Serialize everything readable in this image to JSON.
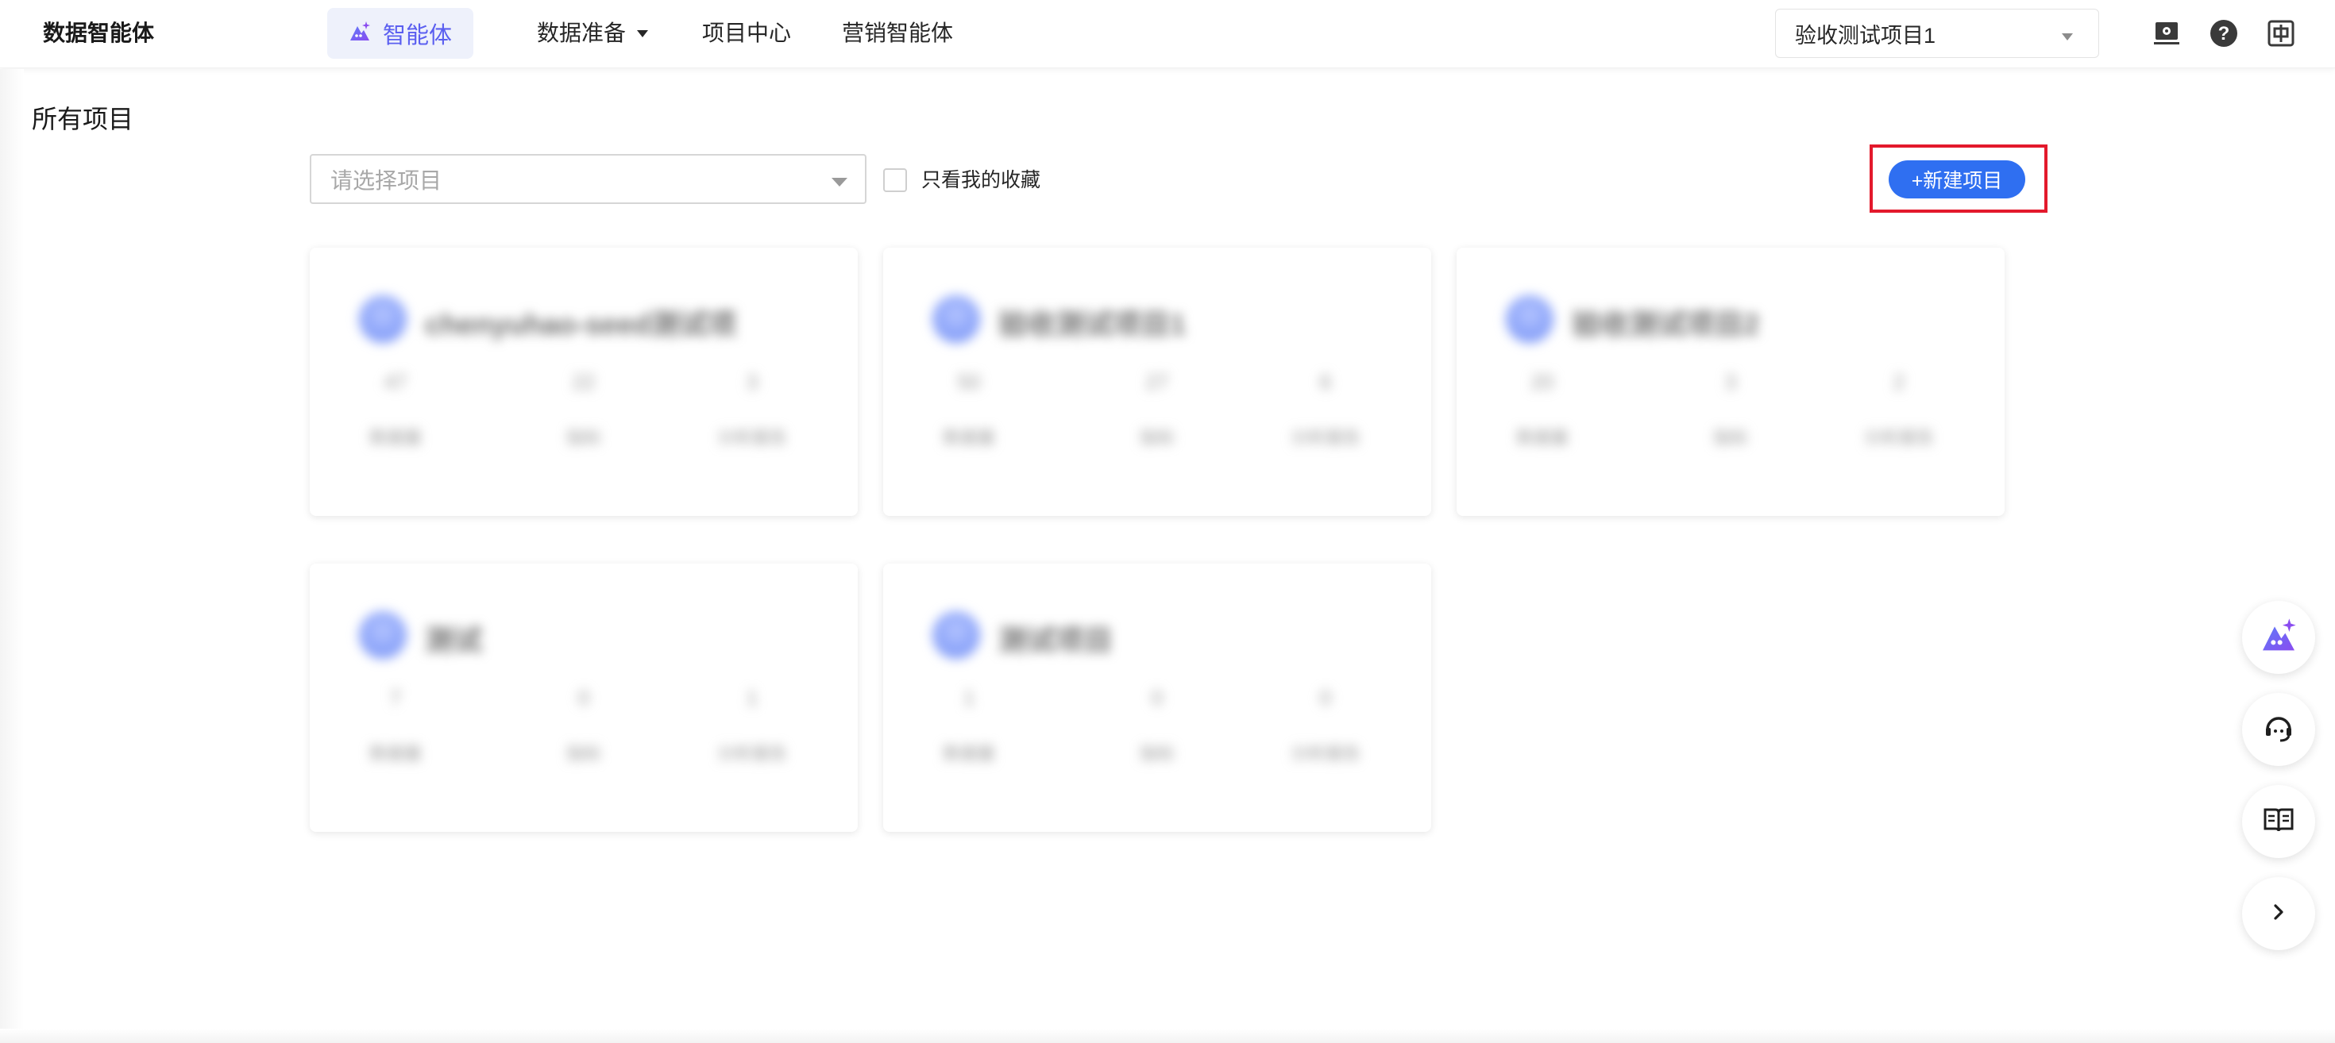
{
  "app": {
    "title": "数据智能体"
  },
  "nav": {
    "active_label": "智能体",
    "items": [
      {
        "label": "数据准备",
        "has_dropdown": true
      },
      {
        "label": "项目中心",
        "has_dropdown": false
      },
      {
        "label": "营销智能体",
        "has_dropdown": false
      }
    ]
  },
  "project_selector": {
    "value": "验收测试项目1"
  },
  "header_icons": [
    "monitor-settings-icon",
    "help-icon",
    "language-icon"
  ],
  "page": {
    "title": "所有项目",
    "filter_placeholder": "请选择项目",
    "fav_only_label": "只看我的收藏",
    "new_project_label": "+新建项目"
  },
  "projects": [
    {
      "name": "chenyuhao-seed测试项",
      "stats": [
        "47",
        "22",
        "3"
      ]
    },
    {
      "name": "验收测试项目1",
      "stats": [
        "50",
        "27",
        "6"
      ]
    },
    {
      "name": "验收测试项目2",
      "stats": [
        "20",
        "3",
        "2"
      ]
    },
    {
      "name": "测试",
      "stats": [
        "7",
        "0",
        "1"
      ]
    },
    {
      "name": "测试项目",
      "stats": [
        "1",
        "0",
        "0"
      ]
    }
  ],
  "project_stat_labels": [
    "数据量",
    "指标",
    "分析报告"
  ],
  "float_actions": [
    "agent-icon",
    "support-icon",
    "guide-book-icon",
    "expand-arrow-icon"
  ],
  "colors": {
    "accent": "#2f6ff1",
    "nav_active": "#5b5ff0",
    "highlight": "#e3192c"
  }
}
